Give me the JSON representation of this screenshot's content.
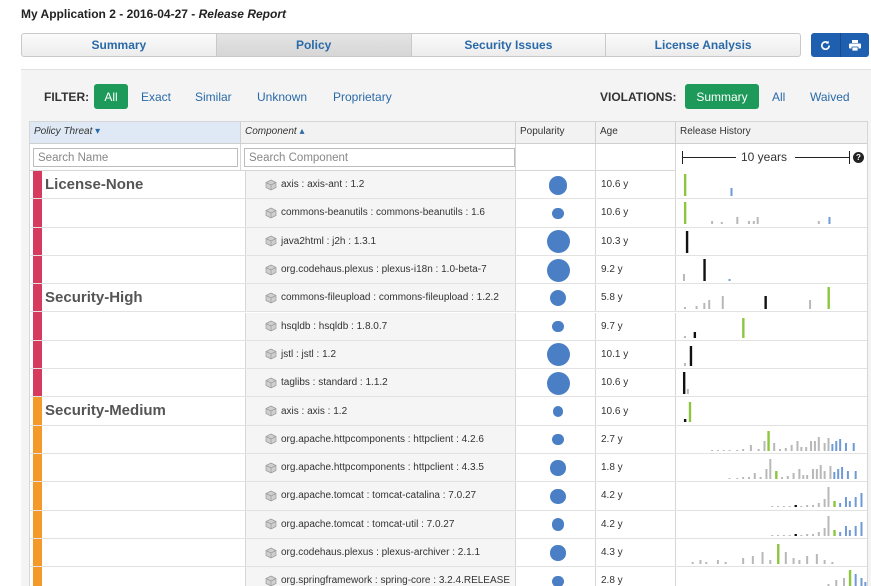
{
  "header": {
    "app_name": "My Application 2 - 2016-04-27 - ",
    "report_name": "Release Report"
  },
  "tabs": [
    {
      "label": "Summary",
      "active": false
    },
    {
      "label": "Policy",
      "active": true
    },
    {
      "label": "Security Issues",
      "active": false
    },
    {
      "label": "License Analysis",
      "active": false
    }
  ],
  "toolbar": {
    "refresh_icon": "refresh-icon",
    "print_icon": "print-icon"
  },
  "filter": {
    "label": "FILTER:",
    "options": [
      "All",
      "Exact",
      "Similar",
      "Unknown",
      "Proprietary"
    ],
    "selected": "All"
  },
  "violations": {
    "label": "VIOLATIONS:",
    "options": [
      "Summary",
      "All",
      "Waived"
    ],
    "selected": "Summary"
  },
  "columns": {
    "threat": "Policy Threat",
    "component": "Component",
    "popularity": "Popularity",
    "age": "Age",
    "history": "Release History"
  },
  "search": {
    "name_placeholder": "Search Name",
    "component_placeholder": "Search Component"
  },
  "timescale": {
    "label": "10 years"
  },
  "colors": {
    "license_none": "#d63a5e",
    "security_high": "#d63a5e",
    "security_medium": "#f39a2b",
    "popularity_dot": "#4a7fc6",
    "release_used": "#111111",
    "release_recommended": "#8cc63f",
    "release_other": "#b8b8b8",
    "release_newer": "#6f9ad6",
    "accent_green": "#1d9a5a",
    "accent_blue": "#1f5fb0"
  },
  "groups": [
    {
      "label": "License-None",
      "color": "#d63a5e",
      "rows": 4
    },
    {
      "label": "Security-High",
      "color": "#d63a5e",
      "rows": 4
    },
    {
      "label": "Security-Medium",
      "color": "#f39a2b",
      "rows": 7
    }
  ],
  "rows": [
    {
      "component": "axis : axis-ant : 1.2",
      "popularity": 0.75,
      "age": "10.6 y",
      "history": [
        [
          2,
          22,
          "r"
        ],
        [
          50,
          8,
          "n"
        ]
      ]
    },
    {
      "component": "commons-beanutils : commons-beanutils : 1.6",
      "popularity": 0.3,
      "age": "10.6 y",
      "history": [
        [
          2,
          22,
          "r"
        ],
        [
          30,
          3,
          "o"
        ],
        [
          40,
          2,
          "o"
        ],
        [
          56,
          7,
          "o"
        ],
        [
          68,
          3,
          "o"
        ],
        [
          73,
          3,
          "o"
        ],
        [
          77,
          7,
          "o"
        ],
        [
          140,
          3,
          "o"
        ],
        [
          151,
          7,
          "n"
        ]
      ]
    },
    {
      "component": "java2html : j2h : 1.3.1",
      "popularity": 1.0,
      "age": "10.3 y",
      "history": [
        [
          4,
          22,
          "u"
        ]
      ]
    },
    {
      "component": "org.codehaus.plexus : plexus-i18n : 1.0-beta-7",
      "popularity": 1.0,
      "age": "9.2 y",
      "history": [
        [
          1,
          7,
          "o"
        ],
        [
          22,
          22,
          "u"
        ],
        [
          48,
          2,
          "n"
        ]
      ]
    },
    {
      "component": "commons-fileupload : commons-fileupload : 1.2.2",
      "popularity": 0.6,
      "age": "5.8 y",
      "history": [
        [
          2,
          2,
          "o"
        ],
        [
          14,
          3,
          "o"
        ],
        [
          22,
          6,
          "o"
        ],
        [
          27,
          9,
          "o"
        ],
        [
          41,
          13,
          "o"
        ],
        [
          85,
          13,
          "u"
        ],
        [
          131,
          9,
          "o"
        ],
        [
          150,
          22,
          "r"
        ]
      ]
    },
    {
      "component": "hsqldb : hsqldb : 1.8.0.7",
      "popularity": 0.3,
      "age": "9.7 y",
      "history": [
        [
          2,
          2,
          "o"
        ],
        [
          12,
          6,
          "u"
        ],
        [
          62,
          20,
          "r"
        ]
      ]
    },
    {
      "component": "jstl : jstl : 1.2",
      "popularity": 1.0,
      "age": "10.1 y",
      "history": [
        [
          2,
          3,
          "o"
        ],
        [
          8,
          20,
          "u"
        ]
      ]
    },
    {
      "component": "taglibs : standard : 1.1.2",
      "popularity": 1.0,
      "age": "10.6 y",
      "history": [
        [
          1,
          22,
          "u"
        ],
        [
          5,
          5,
          "o"
        ]
      ]
    },
    {
      "component": "axis : axis : 1.2",
      "popularity": 0.25,
      "age": "10.6 y",
      "history": [
        [
          2,
          3,
          "u"
        ],
        [
          7,
          20,
          "r"
        ]
      ]
    },
    {
      "component": "org.apache.httpcomponents : httpclient : 4.2.6",
      "popularity": 0.3,
      "age": "2.7 y",
      "history": [
        [
          30,
          1,
          "o"
        ],
        [
          36,
          1,
          "o"
        ],
        [
          42,
          1,
          "o"
        ],
        [
          48,
          1,
          "o"
        ],
        [
          56,
          1,
          "o"
        ],
        [
          62,
          2,
          "o"
        ],
        [
          70,
          6,
          "o"
        ],
        [
          78,
          2,
          "o"
        ],
        [
          84,
          10,
          "o"
        ],
        [
          88,
          20,
          "r"
        ],
        [
          94,
          8,
          "o"
        ],
        [
          100,
          2,
          "o"
        ],
        [
          106,
          3,
          "o"
        ],
        [
          112,
          6,
          "o"
        ],
        [
          118,
          10,
          "o"
        ],
        [
          122,
          4,
          "o"
        ],
        [
          127,
          4,
          "o"
        ],
        [
          132,
          10,
          "o"
        ],
        [
          136,
          10,
          "o"
        ],
        [
          140,
          14,
          "o"
        ],
        [
          146,
          8,
          "o"
        ],
        [
          150,
          13,
          "o"
        ],
        [
          154,
          7,
          "n"
        ],
        [
          158,
          10,
          "n"
        ],
        [
          162,
          12,
          "n"
        ],
        [
          168,
          8,
          "n"
        ],
        [
          176,
          8,
          "n"
        ]
      ]
    },
    {
      "component": "org.apache.httpcomponents : httpclient : 4.3.5",
      "popularity": 0.55,
      "age": "1.8 y",
      "history": [
        [
          48,
          1,
          "o"
        ],
        [
          56,
          1,
          "o"
        ],
        [
          62,
          2,
          "o"
        ],
        [
          68,
          2,
          "o"
        ],
        [
          74,
          6,
          "o"
        ],
        [
          80,
          2,
          "o"
        ],
        [
          86,
          10,
          "o"
        ],
        [
          90,
          20,
          "o"
        ],
        [
          96,
          8,
          "r"
        ],
        [
          102,
          2,
          "o"
        ],
        [
          108,
          3,
          "o"
        ],
        [
          114,
          6,
          "o"
        ],
        [
          120,
          10,
          "o"
        ],
        [
          124,
          4,
          "o"
        ],
        [
          128,
          4,
          "o"
        ],
        [
          134,
          10,
          "o"
        ],
        [
          138,
          10,
          "o"
        ],
        [
          142,
          14,
          "o"
        ],
        [
          146,
          8,
          "o"
        ],
        [
          152,
          13,
          "o"
        ],
        [
          156,
          7,
          "n"
        ],
        [
          160,
          10,
          "n"
        ],
        [
          164,
          12,
          "n"
        ],
        [
          170,
          8,
          "n"
        ],
        [
          178,
          8,
          "n"
        ]
      ]
    },
    {
      "component": "org.apache.tomcat : tomcat-catalina : 7.0.27",
      "popularity": 0.55,
      "age": "4.2 y",
      "history": [
        [
          92,
          1,
          "o"
        ],
        [
          98,
          1,
          "o"
        ],
        [
          104,
          1,
          "o"
        ],
        [
          110,
          1,
          "o"
        ],
        [
          116,
          2,
          "u"
        ],
        [
          122,
          1,
          "o"
        ],
        [
          128,
          2,
          "o"
        ],
        [
          134,
          2,
          "o"
        ],
        [
          140,
          4,
          "o"
        ],
        [
          146,
          8,
          "o"
        ],
        [
          150,
          20,
          "o"
        ],
        [
          156,
          6,
          "r"
        ],
        [
          162,
          4,
          "n"
        ],
        [
          168,
          10,
          "n"
        ],
        [
          172,
          6,
          "n"
        ],
        [
          178,
          10,
          "n"
        ],
        [
          184,
          14,
          "n"
        ]
      ]
    },
    {
      "component": "org.apache.tomcat : tomcat-util : 7.0.27",
      "popularity": 0.4,
      "age": "4.2 y",
      "history": [
        [
          92,
          1,
          "o"
        ],
        [
          98,
          1,
          "o"
        ],
        [
          104,
          1,
          "o"
        ],
        [
          110,
          1,
          "o"
        ],
        [
          116,
          2,
          "u"
        ],
        [
          122,
          1,
          "o"
        ],
        [
          128,
          2,
          "o"
        ],
        [
          134,
          2,
          "o"
        ],
        [
          140,
          4,
          "o"
        ],
        [
          146,
          8,
          "o"
        ],
        [
          150,
          20,
          "o"
        ],
        [
          156,
          6,
          "r"
        ],
        [
          162,
          4,
          "n"
        ],
        [
          168,
          10,
          "n"
        ],
        [
          172,
          6,
          "n"
        ],
        [
          178,
          10,
          "n"
        ],
        [
          184,
          14,
          "n"
        ]
      ]
    },
    {
      "component": "org.codehaus.plexus : plexus-archiver : 2.1.1",
      "popularity": 0.55,
      "age": "4.3 y",
      "history": [
        [
          10,
          2,
          "o"
        ],
        [
          18,
          4,
          "o"
        ],
        [
          24,
          2,
          "o"
        ],
        [
          36,
          4,
          "o"
        ],
        [
          44,
          2,
          "o"
        ],
        [
          62,
          6,
          "o"
        ],
        [
          72,
          8,
          "o"
        ],
        [
          82,
          12,
          "o"
        ],
        [
          90,
          4,
          "o"
        ],
        [
          98,
          20,
          "r"
        ],
        [
          106,
          12,
          "o"
        ],
        [
          114,
          6,
          "o"
        ],
        [
          120,
          4,
          "o"
        ],
        [
          128,
          8,
          "o"
        ],
        [
          138,
          10,
          "o"
        ],
        [
          146,
          4,
          "o"
        ],
        [
          154,
          2,
          "o"
        ]
      ]
    },
    {
      "component": "org.springframework : spring-core : 3.2.4.RELEASE",
      "popularity": 0.3,
      "age": "2.8 y",
      "history": [
        [
          116,
          2,
          "o"
        ],
        [
          128,
          4,
          "o"
        ],
        [
          140,
          6,
          "o"
        ],
        [
          150,
          8,
          "o"
        ],
        [
          158,
          12,
          "o"
        ],
        [
          166,
          14,
          "o"
        ],
        [
          172,
          22,
          "r"
        ],
        [
          178,
          18,
          "n"
        ],
        [
          184,
          14,
          "n"
        ],
        [
          188,
          10,
          "n"
        ]
      ]
    }
  ]
}
